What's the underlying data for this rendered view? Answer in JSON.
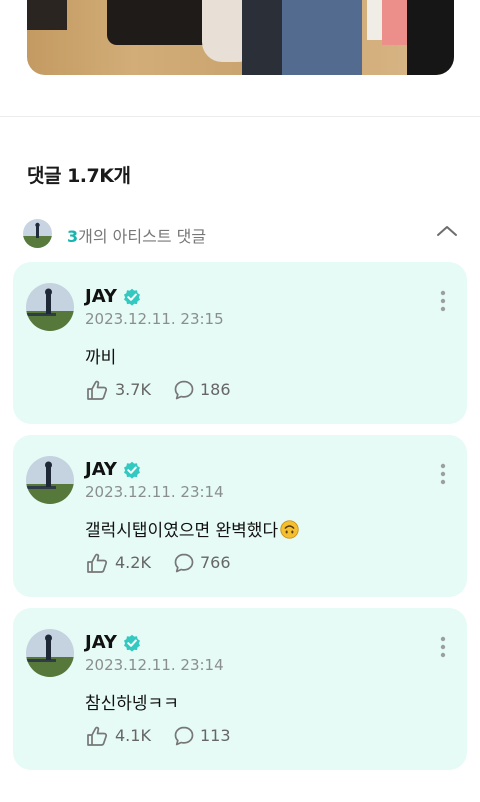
{
  "comments_header": {
    "prefix": "댓글 ",
    "count": "1.7K",
    "suffix": "개"
  },
  "artist_section": {
    "count": "3",
    "label": "개의 아티스트 댓글",
    "collapse_icon": "chevron-up-icon"
  },
  "comments": [
    {
      "author": "JAY",
      "verified": true,
      "date": "2023.12.11. 23:15",
      "text": "까비",
      "emoji": "",
      "likes": "3.7K",
      "replies": "186"
    },
    {
      "author": "JAY",
      "verified": true,
      "date": "2023.12.11. 23:14",
      "text": "갤럭시탭이였으면 완벽했다",
      "emoji": "upside-down-face",
      "likes": "4.2K",
      "replies": "766"
    },
    {
      "author": "JAY",
      "verified": true,
      "date": "2023.12.11. 23:14",
      "text": "참신하넹ㅋㅋ",
      "emoji": "",
      "likes": "4.1K",
      "replies": "113"
    }
  ],
  "colors": {
    "accent": "#16b5b0",
    "card_bg": "#e6fbf6",
    "verified": "#33c9c1"
  }
}
